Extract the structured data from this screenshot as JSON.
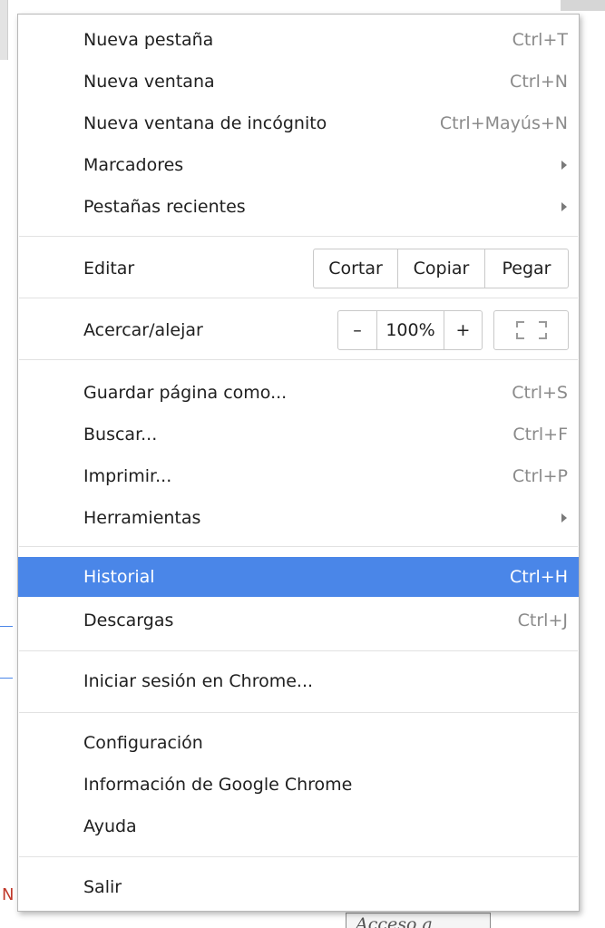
{
  "background": {
    "partial_letter": "N",
    "taskbar_button_text": "Acceso a Internet"
  },
  "menu": {
    "new_tab": {
      "label": "Nueva pestaña",
      "shortcut": "Ctrl+T"
    },
    "new_window": {
      "label": "Nueva ventana",
      "shortcut": "Ctrl+N"
    },
    "incognito": {
      "label": "Nueva ventana de incógnito",
      "shortcut": "Ctrl+Mayús+N"
    },
    "bookmarks": {
      "label": "Marcadores",
      "icon": "chevron-right-icon"
    },
    "recent_tabs": {
      "label": "Pestañas recientes",
      "icon": "chevron-right-icon"
    },
    "edit": {
      "label": "Editar",
      "cut": "Cortar",
      "copy": "Copiar",
      "paste": "Pegar"
    },
    "zoom": {
      "label": "Acercar/alejar",
      "minus": "–",
      "level": "100%",
      "plus": "+",
      "fullscreen_icon": "fullscreen-icon"
    },
    "save_page": {
      "label": "Guardar página como...",
      "shortcut": "Ctrl+S"
    },
    "find": {
      "label": "Buscar...",
      "shortcut": "Ctrl+F"
    },
    "print": {
      "label": "Imprimir...",
      "shortcut": "Ctrl+P"
    },
    "tools": {
      "label": "Herramientas",
      "icon": "chevron-right-icon"
    },
    "history": {
      "label": "Historial",
      "shortcut": "Ctrl+H",
      "highlighted": true
    },
    "downloads": {
      "label": "Descargas",
      "shortcut": "Ctrl+J"
    },
    "sign_in": {
      "label": "Iniciar sesión en Chrome..."
    },
    "settings": {
      "label": "Configuración"
    },
    "about": {
      "label": "Información de Google Chrome"
    },
    "help": {
      "label": "Ayuda"
    },
    "exit": {
      "label": "Salir"
    }
  },
  "colors": {
    "highlight": "#4a86e8",
    "shortcut_text": "#8a8a8a",
    "separator": "#e2e2e2"
  }
}
